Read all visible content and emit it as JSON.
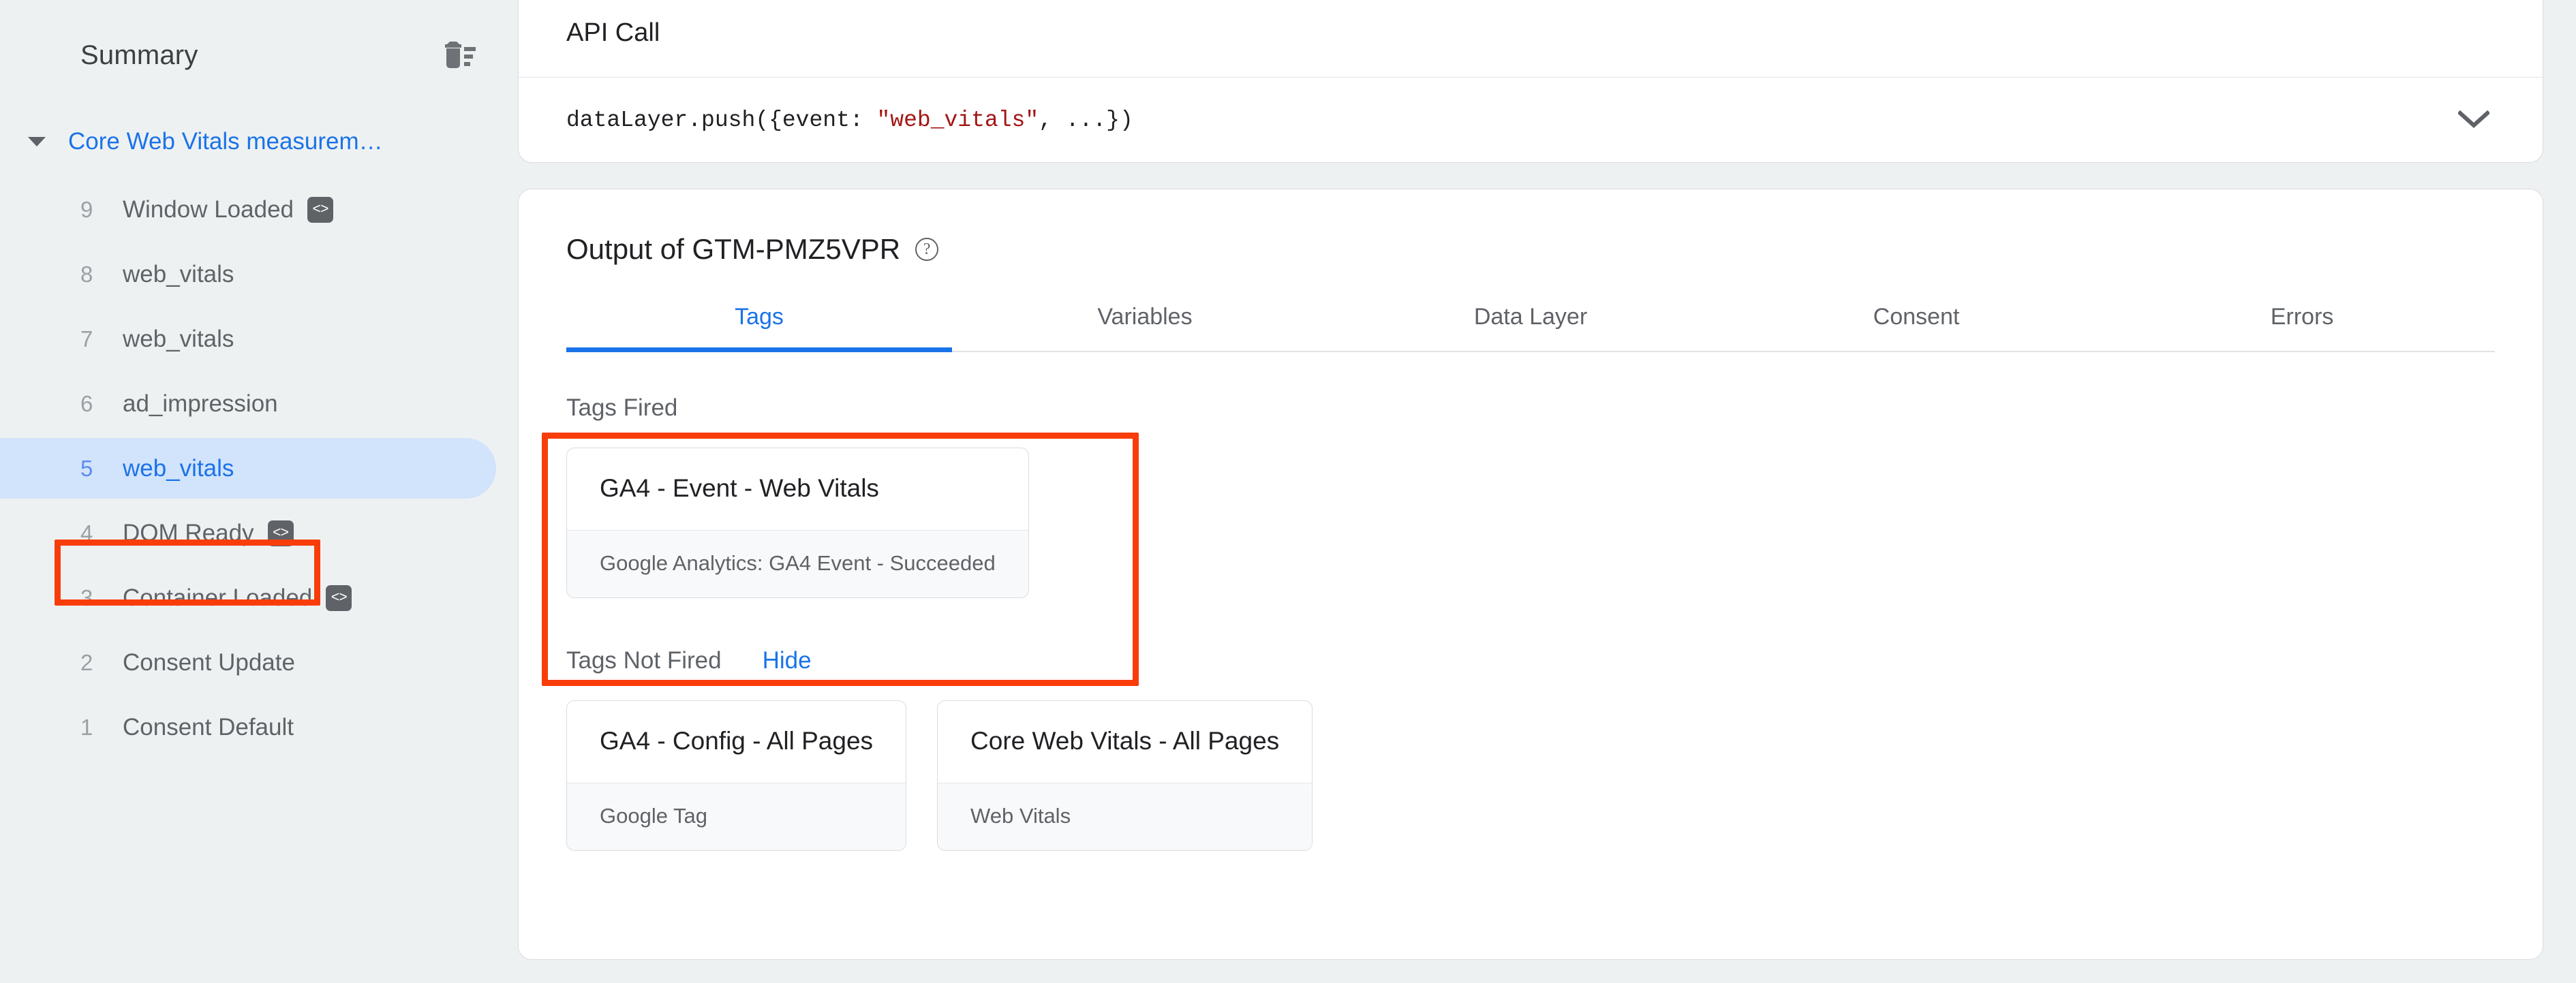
{
  "sidebar": {
    "title": "Summary",
    "clear_icon": "trash-with-lines-icon",
    "group": {
      "label": "Core Web Vitals measurem…",
      "expanded": true,
      "caret_icon": "caret-down-icon"
    },
    "events": [
      {
        "num": "9",
        "label": "Window Loaded",
        "badge": "<>",
        "badge_icon": "code-badge-icon",
        "selected": false
      },
      {
        "num": "8",
        "label": "web_vitals",
        "badge": "",
        "badge_icon": "",
        "selected": false
      },
      {
        "num": "7",
        "label": "web_vitals",
        "badge": "",
        "badge_icon": "",
        "selected": false
      },
      {
        "num": "6",
        "label": "ad_impression",
        "badge": "",
        "badge_icon": "",
        "selected": false
      },
      {
        "num": "5",
        "label": "web_vitals",
        "badge": "",
        "badge_icon": "",
        "selected": true
      },
      {
        "num": "4",
        "label": "DOM Ready",
        "badge": "<>",
        "badge_icon": "code-badge-icon",
        "selected": false
      },
      {
        "num": "3",
        "label": "Container Loaded",
        "badge": "<>",
        "badge_icon": "code-badge-icon",
        "selected": false
      },
      {
        "num": "2",
        "label": "Consent Update",
        "badge": "",
        "badge_icon": "",
        "selected": false
      },
      {
        "num": "1",
        "label": "Consent Default",
        "badge": "",
        "badge_icon": "",
        "selected": false
      }
    ]
  },
  "api_call": {
    "title": "API Call",
    "code_prefix": "dataLayer.push({event: ",
    "code_string": "\"web_vitals\"",
    "code_suffix": ", ...})",
    "expand_icon": "chevron-down-icon"
  },
  "output": {
    "title": "Output of GTM-PMZ5VPR",
    "help_icon": "help-circle-icon",
    "help_glyph": "?",
    "tabs": [
      {
        "label": "Tags",
        "active": true
      },
      {
        "label": "Variables",
        "active": false
      },
      {
        "label": "Data Layer",
        "active": false
      },
      {
        "label": "Consent",
        "active": false
      },
      {
        "label": "Errors",
        "active": false
      }
    ],
    "tags_fired": {
      "section_label": "Tags Fired",
      "cards": [
        {
          "name": "GA4 - Event - Web Vitals",
          "sub": "Google Analytics: GA4 Event - Succeeded"
        }
      ]
    },
    "tags_not_fired": {
      "section_label": "Tags Not Fired",
      "toggle_label": "Hide",
      "cards": [
        {
          "name": "GA4 - Config - All Pages",
          "sub": "Google Tag"
        },
        {
          "name": "Core Web Vitals - All Pages",
          "sub": "Web Vitals"
        }
      ]
    }
  },
  "annotations": {
    "highlight_color": "#f93d0a",
    "boxes": [
      {
        "target": "sidebar-event-5"
      },
      {
        "target": "tags-fired-section"
      }
    ]
  },
  "colors": {
    "accent_blue": "#1a73e8",
    "selection_pill": "#d2e3fc",
    "page_background": "#eef1f2",
    "card_background": "#ffffff",
    "code_string": "#a31515"
  }
}
